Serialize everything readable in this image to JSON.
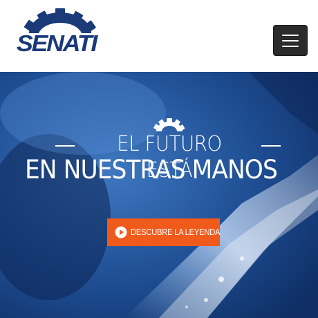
{
  "header": {
    "logo_text": "SENATI",
    "menu_button_label": "Toggle navigation"
  },
  "hero": {
    "tagline_top": "EL FUTURO ESTÁ",
    "tagline_bottom": "EN NUESTRAS MANOS",
    "cta_label": "DESCUBRE LA LEYENDA"
  },
  "icons": {
    "logo_gear": "gear-icon",
    "hero_gear": "gear-icon",
    "play": "play-icon",
    "menu": "hamburger-icon"
  },
  "colors": {
    "brand_navy": "#1a3a78",
    "cta_orange": "#f05a1a",
    "menu_button": "#2b2b2b"
  }
}
